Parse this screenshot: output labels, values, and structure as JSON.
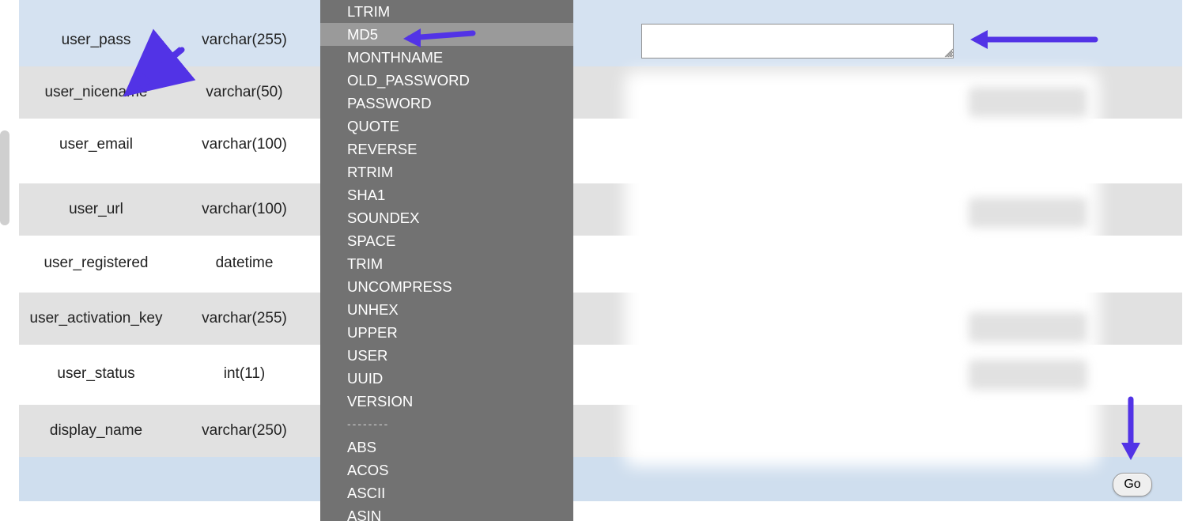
{
  "rows": [
    {
      "name": "",
      "type": "",
      "bg": "lightblue"
    },
    {
      "name": "user_pass",
      "type": "varchar(255)",
      "bg": "lightblue"
    },
    {
      "name": "user_nicename",
      "type": "varchar(50)",
      "bg": "gray"
    },
    {
      "name": "user_email",
      "type": "varchar(100)",
      "bg": "white"
    },
    {
      "name": "user_url",
      "type": "varchar(100)",
      "bg": "gray"
    },
    {
      "name": "user_registered",
      "type": "datetime",
      "bg": "white"
    },
    {
      "name": "user_activation_key",
      "type": "varchar(255)",
      "bg": "gray"
    },
    {
      "name": "user_status",
      "type": "int(11)",
      "bg": "white"
    },
    {
      "name": "display_name",
      "type": "varchar(250)",
      "bg": "gray"
    }
  ],
  "dropdown": {
    "items": [
      {
        "label": "LTRIM",
        "highlight": false
      },
      {
        "label": "MD5",
        "highlight": true
      },
      {
        "label": "MONTHNAME",
        "highlight": false
      },
      {
        "label": "OLD_PASSWORD",
        "highlight": false
      },
      {
        "label": "PASSWORD",
        "highlight": false
      },
      {
        "label": "QUOTE",
        "highlight": false
      },
      {
        "label": "REVERSE",
        "highlight": false
      },
      {
        "label": "RTRIM",
        "highlight": false
      },
      {
        "label": "SHA1",
        "highlight": false
      },
      {
        "label": "SOUNDEX",
        "highlight": false
      },
      {
        "label": "SPACE",
        "highlight": false
      },
      {
        "label": "TRIM",
        "highlight": false
      },
      {
        "label": "UNCOMPRESS",
        "highlight": false
      },
      {
        "label": "UNHEX",
        "highlight": false
      },
      {
        "label": "UPPER",
        "highlight": false
      },
      {
        "label": "USER",
        "highlight": false
      },
      {
        "label": "UUID",
        "highlight": false
      },
      {
        "label": "VERSION",
        "highlight": false
      }
    ],
    "sep": "--------",
    "items2": [
      {
        "label": "ABS"
      },
      {
        "label": "ACOS"
      },
      {
        "label": "ASCII"
      },
      {
        "label": "ASIN"
      }
    ]
  },
  "value_input": {
    "value": ""
  },
  "go_button": {
    "label": "Go"
  },
  "annotation_color": "#5233e6"
}
